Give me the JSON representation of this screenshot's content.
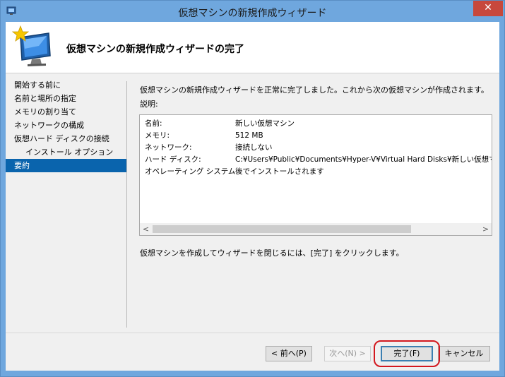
{
  "window": {
    "title": "仮想マシンの新規作成ウィザード",
    "close_glyph": "✕"
  },
  "header": {
    "title": "仮想マシンの新規作成ウィザードの完了"
  },
  "nav": {
    "items": [
      {
        "label": "開始する前に"
      },
      {
        "label": "名前と場所の指定"
      },
      {
        "label": "メモリの割り当て"
      },
      {
        "label": "ネットワークの構成"
      },
      {
        "label": "仮想ハード ディスクの接続"
      },
      {
        "label": "インストール オプション"
      },
      {
        "label": "要約"
      }
    ]
  },
  "main": {
    "intro": "仮想マシンの新規作成ウィザードを正常に完了しました。これから次の仮想マシンが作成されます。",
    "description_label": "説明:",
    "summary": [
      {
        "key": "名前:",
        "value": "新しい仮想マシン"
      },
      {
        "key": "メモリ:",
        "value": "512 MB"
      },
      {
        "key": "ネットワーク:",
        "value": "接続しない"
      },
      {
        "key": "ハード ディスク:",
        "value": "C:¥Users¥Public¥Documents¥Hyper-V¥Virtual Hard Disks¥新しい仮想マシン"
      },
      {
        "key": "オペレーティング システム:",
        "value": "後でインストールされます"
      }
    ],
    "scroll_left": "<",
    "scroll_right": ">",
    "finish_note": "仮想マシンを作成してウィザードを閉じるには、[完了] をクリックします。"
  },
  "buttons": {
    "back": "< 前へ(P)",
    "next": "次へ(N) >",
    "finish": "完了(F)",
    "cancel": "キャンセル"
  },
  "icons": {
    "app": "hyper-v-app-icon",
    "wizard": "new-vm-wizard-icon"
  },
  "colors": {
    "titlebar": "#6fa7de",
    "close": "#c7483c",
    "selection": "#0a64ad",
    "highlight": "#d3181f"
  }
}
